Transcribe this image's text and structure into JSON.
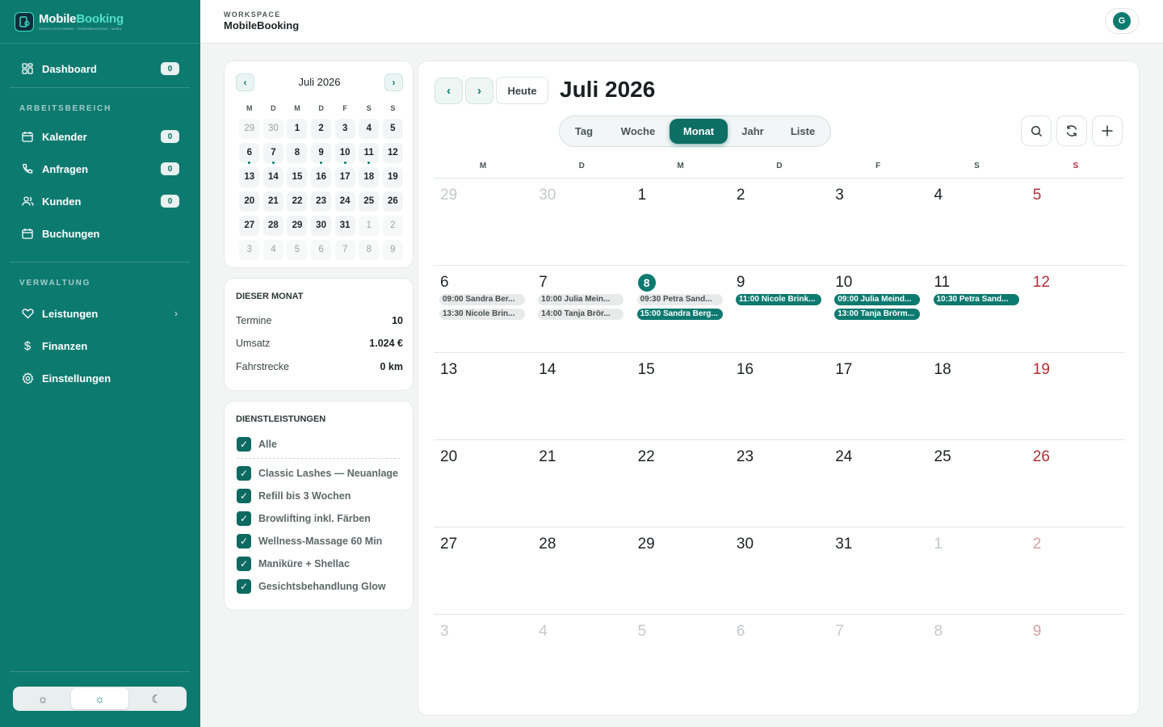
{
  "brand": {
    "name_part1": "Mobile",
    "name_part2": "Booking",
    "tagline": "DIENSTLEISTUNGEN · TERMINBUCHUNG · MOBIL"
  },
  "sidebar": {
    "dashboard": {
      "label": "Dashboard",
      "count": "0"
    },
    "section_work": "ARBEITSBEREICH",
    "work_items": [
      {
        "label": "Kalender",
        "count": "0"
      },
      {
        "label": "Anfragen",
        "count": "0"
      },
      {
        "label": "Kunden",
        "count": "0"
      },
      {
        "label": "Buchungen"
      }
    ],
    "section_admin": "VERWALTUNG",
    "admin_items": [
      {
        "label": "Leistungen"
      },
      {
        "label": "Finanzen"
      },
      {
        "label": "Einstellungen"
      }
    ]
  },
  "topbar": {
    "workspace_label": "WORKSPACE",
    "workspace_name": "MobileBooking",
    "avatar_initial": "G"
  },
  "mini_calendar": {
    "title": "Juli 2026",
    "weekdays": [
      "M",
      "D",
      "M",
      "D",
      "F",
      "S",
      "S"
    ],
    "days": [
      {
        "d": "29",
        "muted": true
      },
      {
        "d": "30",
        "muted": true
      },
      {
        "d": "1"
      },
      {
        "d": "2"
      },
      {
        "d": "3"
      },
      {
        "d": "4"
      },
      {
        "d": "5"
      },
      {
        "d": "6",
        "dot": true
      },
      {
        "d": "7",
        "dot": true
      },
      {
        "d": "8"
      },
      {
        "d": "9",
        "dot": true
      },
      {
        "d": "10",
        "dot": true
      },
      {
        "d": "11",
        "dot": true
      },
      {
        "d": "12"
      },
      {
        "d": "13"
      },
      {
        "d": "14"
      },
      {
        "d": "15"
      },
      {
        "d": "16"
      },
      {
        "d": "17"
      },
      {
        "d": "18"
      },
      {
        "d": "19"
      },
      {
        "d": "20"
      },
      {
        "d": "21"
      },
      {
        "d": "22"
      },
      {
        "d": "23"
      },
      {
        "d": "24"
      },
      {
        "d": "25"
      },
      {
        "d": "26"
      },
      {
        "d": "27"
      },
      {
        "d": "28"
      },
      {
        "d": "29"
      },
      {
        "d": "30"
      },
      {
        "d": "31"
      },
      {
        "d": "1",
        "muted": true
      },
      {
        "d": "2",
        "muted": true
      },
      {
        "d": "3",
        "muted": true
      },
      {
        "d": "4",
        "muted": true
      },
      {
        "d": "5",
        "muted": true
      },
      {
        "d": "6",
        "muted": true
      },
      {
        "d": "7",
        "muted": true
      },
      {
        "d": "8",
        "muted": true
      },
      {
        "d": "9",
        "muted": true
      }
    ]
  },
  "stats": {
    "title": "DIESER MONAT",
    "rows": [
      {
        "label": "Termine",
        "value": "10"
      },
      {
        "label": "Umsatz",
        "value": "1.024 €"
      },
      {
        "label": "Fahrstrecke",
        "value": "0 km"
      }
    ]
  },
  "services": {
    "title": "DIENSTLEISTUNGEN",
    "all_label": "Alle",
    "items": [
      "Classic Lashes — Neuanlage",
      "Refill bis 3 Wochen",
      "Browlifting inkl. Färben",
      "Wellness-Massage 60 Min",
      "Maniküre + Shellac",
      "Gesichtsbehandlung Glow"
    ]
  },
  "calendar": {
    "today_label": "Heute",
    "title": "Juli 2026",
    "views": [
      "Tag",
      "Woche",
      "Monat",
      "Jahr",
      "Liste"
    ],
    "active_view": "Monat",
    "weekdays": [
      "M",
      "D",
      "M",
      "D",
      "F",
      "S",
      "S"
    ],
    "weeks": [
      [
        {
          "d": "29",
          "muted": true
        },
        {
          "d": "30",
          "muted": true
        },
        {
          "d": "1"
        },
        {
          "d": "2"
        },
        {
          "d": "3"
        },
        {
          "d": "4"
        },
        {
          "d": "5"
        }
      ],
      [
        {
          "d": "6",
          "events": [
            {
              "text": "09:00 Sandra Ber...",
              "state": "past"
            },
            {
              "text": "13:30 Nicole Brin...",
              "state": "past"
            }
          ]
        },
        {
          "d": "7",
          "events": [
            {
              "text": "10:00 Julia Mein...",
              "state": "past"
            },
            {
              "text": "14:00 Tanja Brör...",
              "state": "past"
            }
          ]
        },
        {
          "d": "8",
          "today": true,
          "events": [
            {
              "text": "09:30 Petra Sand...",
              "state": "past"
            },
            {
              "text": "15:00 Sandra Berg...",
              "state": "up"
            }
          ]
        },
        {
          "d": "9",
          "events": [
            {
              "text": "11:00 Nicole Brink...",
              "state": "up"
            }
          ]
        },
        {
          "d": "10",
          "events": [
            {
              "text": "09:00 Julia Meind...",
              "state": "up"
            },
            {
              "text": "13:00 Tanja Brörm...",
              "state": "up"
            }
          ]
        },
        {
          "d": "11",
          "events": [
            {
              "text": "10:30 Petra Sand...",
              "state": "up"
            }
          ]
        },
        {
          "d": "12"
        }
      ],
      [
        {
          "d": "13"
        },
        {
          "d": "14"
        },
        {
          "d": "15"
        },
        {
          "d": "16"
        },
        {
          "d": "17"
        },
        {
          "d": "18"
        },
        {
          "d": "19"
        }
      ],
      [
        {
          "d": "20"
        },
        {
          "d": "21"
        },
        {
          "d": "22"
        },
        {
          "d": "23"
        },
        {
          "d": "24"
        },
        {
          "d": "25"
        },
        {
          "d": "26"
        }
      ],
      [
        {
          "d": "27"
        },
        {
          "d": "28"
        },
        {
          "d": "29"
        },
        {
          "d": "30"
        },
        {
          "d": "31"
        },
        {
          "d": "1",
          "muted": true
        },
        {
          "d": "2",
          "muted": true
        }
      ],
      [
        {
          "d": "3",
          "muted": true
        },
        {
          "d": "4",
          "muted": true
        },
        {
          "d": "5",
          "muted": true
        },
        {
          "d": "6",
          "muted": true
        },
        {
          "d": "7",
          "muted": true
        },
        {
          "d": "8",
          "muted": true
        },
        {
          "d": "9",
          "muted": true
        }
      ]
    ]
  },
  "icons": {
    "dashboard": "grid-icon",
    "calendar": "calendar-icon",
    "requests": "phone-icon",
    "customers": "users-icon",
    "bookings": "calendar-icon",
    "services": "heart-icon",
    "finance": "dollar-icon",
    "settings": "gear-icon",
    "search": "search-icon",
    "refresh": "refresh-icon",
    "add": "plus-icon"
  },
  "colors": {
    "accent": "#0d7a70",
    "sunday": "#b52d35",
    "sidebar_bg": "#0d7a70"
  }
}
